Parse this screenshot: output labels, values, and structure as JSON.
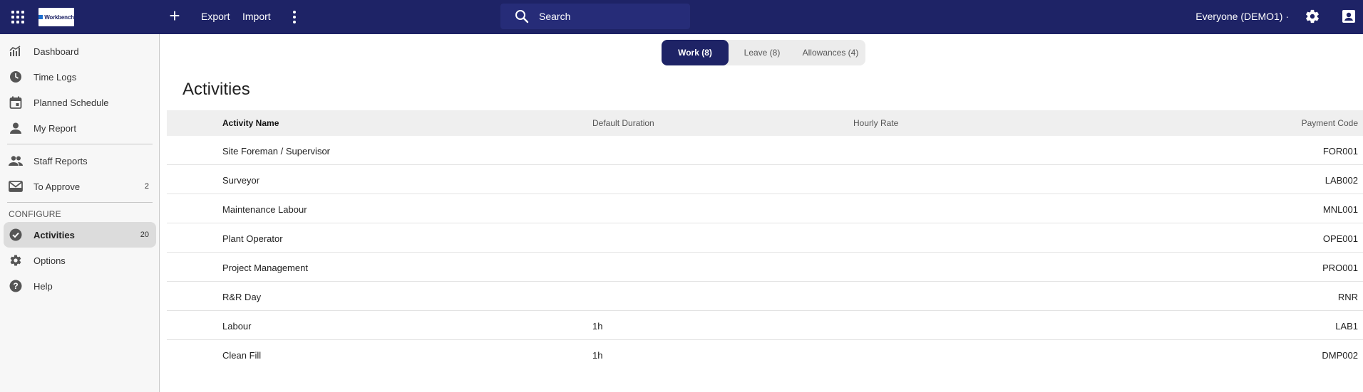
{
  "header": {
    "logo_text": "Workbench",
    "export_label": "Export",
    "import_label": "Import",
    "search_placeholder": "Search",
    "org_selector": "Everyone (DEMO1) ·"
  },
  "sidebar": {
    "items": [
      {
        "label": "Dashboard",
        "icon": "chart-icon"
      },
      {
        "label": "Time Logs",
        "icon": "clock-icon"
      },
      {
        "label": "Planned Schedule",
        "icon": "calendar-icon"
      },
      {
        "label": "My Report",
        "icon": "person-icon"
      },
      {
        "label": "Staff Reports",
        "icon": "people-icon"
      },
      {
        "label": "To Approve",
        "icon": "inbox-icon",
        "count": "2"
      }
    ],
    "section_label": "CONFIGURE",
    "config_items": [
      {
        "label": "Activities",
        "icon": "check-circle-icon",
        "count": "20",
        "active": true
      },
      {
        "label": "Options",
        "icon": "gear-icon"
      },
      {
        "label": "Help",
        "icon": "help-icon"
      }
    ]
  },
  "tabs": [
    {
      "label": "Work (8)",
      "active": true
    },
    {
      "label": "Leave (8)"
    },
    {
      "label": "Allowances (4)"
    }
  ],
  "page_title": "Activities",
  "table": {
    "columns": [
      "Activity Name",
      "Default Duration",
      "Hourly Rate",
      "Payment Code"
    ],
    "rows": [
      {
        "name": "Site Foreman / Supervisor",
        "duration": "",
        "rate": "",
        "code": "FOR001"
      },
      {
        "name": "Surveyor",
        "duration": "",
        "rate": "",
        "code": "LAB002"
      },
      {
        "name": "Maintenance Labour",
        "duration": "",
        "rate": "",
        "code": "MNL001"
      },
      {
        "name": "Plant Operator",
        "duration": "",
        "rate": "",
        "code": "OPE001"
      },
      {
        "name": "Project Management",
        "duration": "",
        "rate": "",
        "code": "PRO001"
      },
      {
        "name": "R&R Day",
        "duration": "",
        "rate": "",
        "code": "RNR"
      },
      {
        "name": "Labour",
        "duration": "1h",
        "rate": "",
        "code": "LAB1"
      },
      {
        "name": "Clean Fill",
        "duration": "1h",
        "rate": "",
        "code": "DMP002"
      }
    ]
  },
  "colors": {
    "primary": "#1e2366",
    "sidebar_bg": "#f7f7f7",
    "active_bg": "#dcdcdc"
  }
}
